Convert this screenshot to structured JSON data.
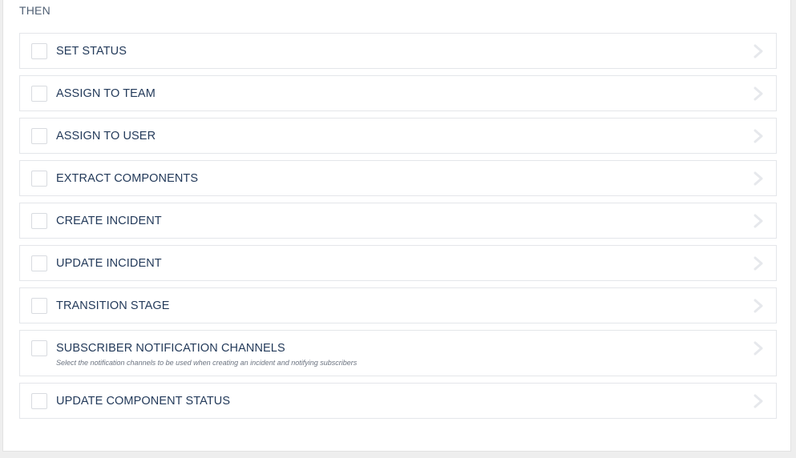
{
  "section": {
    "title": "THEN"
  },
  "actions": [
    {
      "label": "SET STATUS",
      "description": "",
      "icon": "chevron-right-icon"
    },
    {
      "label": "ASSIGN TO TEAM",
      "description": "",
      "icon": "chevron-right-icon"
    },
    {
      "label": "ASSIGN TO USER",
      "description": "",
      "icon": "chevron-right-icon"
    },
    {
      "label": "EXTRACT COMPONENTS",
      "description": "",
      "icon": "chevron-right-icon"
    },
    {
      "label": "CREATE INCIDENT",
      "description": "",
      "icon": "chevron-right-icon"
    },
    {
      "label": "UPDATE INCIDENT",
      "description": "",
      "icon": "chevron-right-icon"
    },
    {
      "label": "TRANSITION STAGE",
      "description": "",
      "icon": "chevron-right-icon"
    },
    {
      "label": "SUBSCRIBER NOTIFICATION CHANNELS",
      "description": "Select the notification channels to be used when creating an incident and notifying subscribers",
      "icon": "chevron-right-icon"
    },
    {
      "label": "UPDATE COMPONENT STATUS",
      "description": "",
      "icon": "chevron-right-icon"
    }
  ],
  "colors": {
    "label_text": "#233a5a",
    "border": "#e4e6ea",
    "chevron": "#e6e8ec",
    "background": "#eeeeee"
  }
}
